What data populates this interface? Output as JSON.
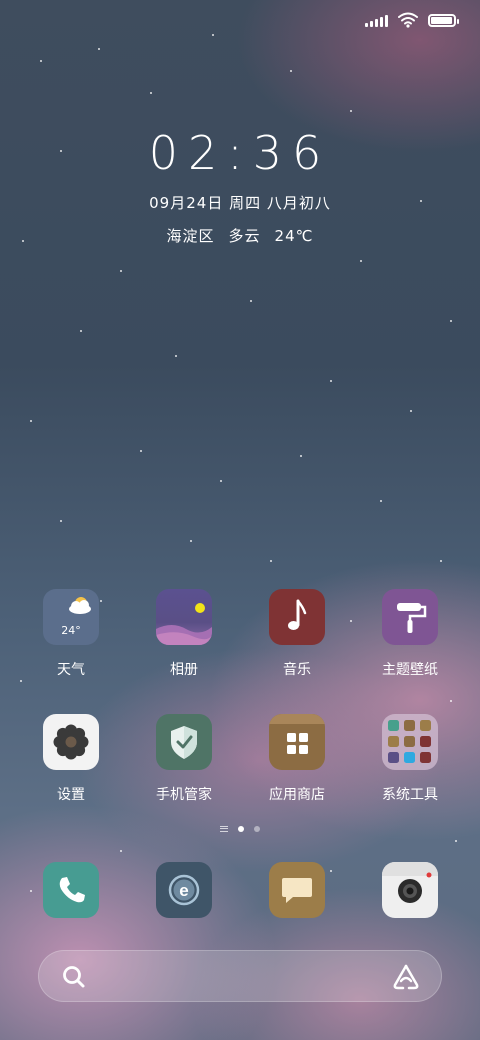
{
  "status_bar": {
    "signal_icon": "signal-icon",
    "wifi_icon": "wifi-icon",
    "battery_icon": "battery-icon",
    "battery_level": 0.95
  },
  "lock_clock": {
    "time": "02:36",
    "date": "09月24日 周四 八月初八",
    "location": "海淀区",
    "condition": "多云",
    "temperature": "24℃"
  },
  "apps_row1": [
    {
      "label": "天气",
      "icon": "weather-icon",
      "tile_text": "24°",
      "color": "#5b6e8c"
    },
    {
      "label": "相册",
      "icon": "gallery-icon",
      "color": "#5a4f86"
    },
    {
      "label": "音乐",
      "icon": "music-note-icon",
      "color": "#7f3334"
    },
    {
      "label": "主题壁纸",
      "icon": "paint-roller-icon",
      "color": "#7f5594"
    }
  ],
  "apps_row2": [
    {
      "label": "设置",
      "icon": "gear-icon",
      "color": "#f3f3f3"
    },
    {
      "label": "手机管家",
      "icon": "shield-icon",
      "color": "#4f7466"
    },
    {
      "label": "应用商店",
      "icon": "app-store-icon",
      "color": "#8c6c43"
    },
    {
      "label": "系统工具",
      "icon": "folder-icon",
      "color": "#c6b5c7"
    }
  ],
  "page_indicator": {
    "pages": 2,
    "current": 1
  },
  "dock": [
    {
      "name": "phone",
      "icon": "phone-icon",
      "color": "#479c92"
    },
    {
      "name": "browser",
      "icon": "browser-icon",
      "color": "#3f5568"
    },
    {
      "name": "messages",
      "icon": "message-icon",
      "color": "#9c7d49"
    },
    {
      "name": "camera",
      "icon": "camera-icon",
      "color": "#efefef"
    }
  ],
  "search_bar": {
    "search_icon": "search-icon",
    "assistant_icon": "assistant-icon"
  }
}
